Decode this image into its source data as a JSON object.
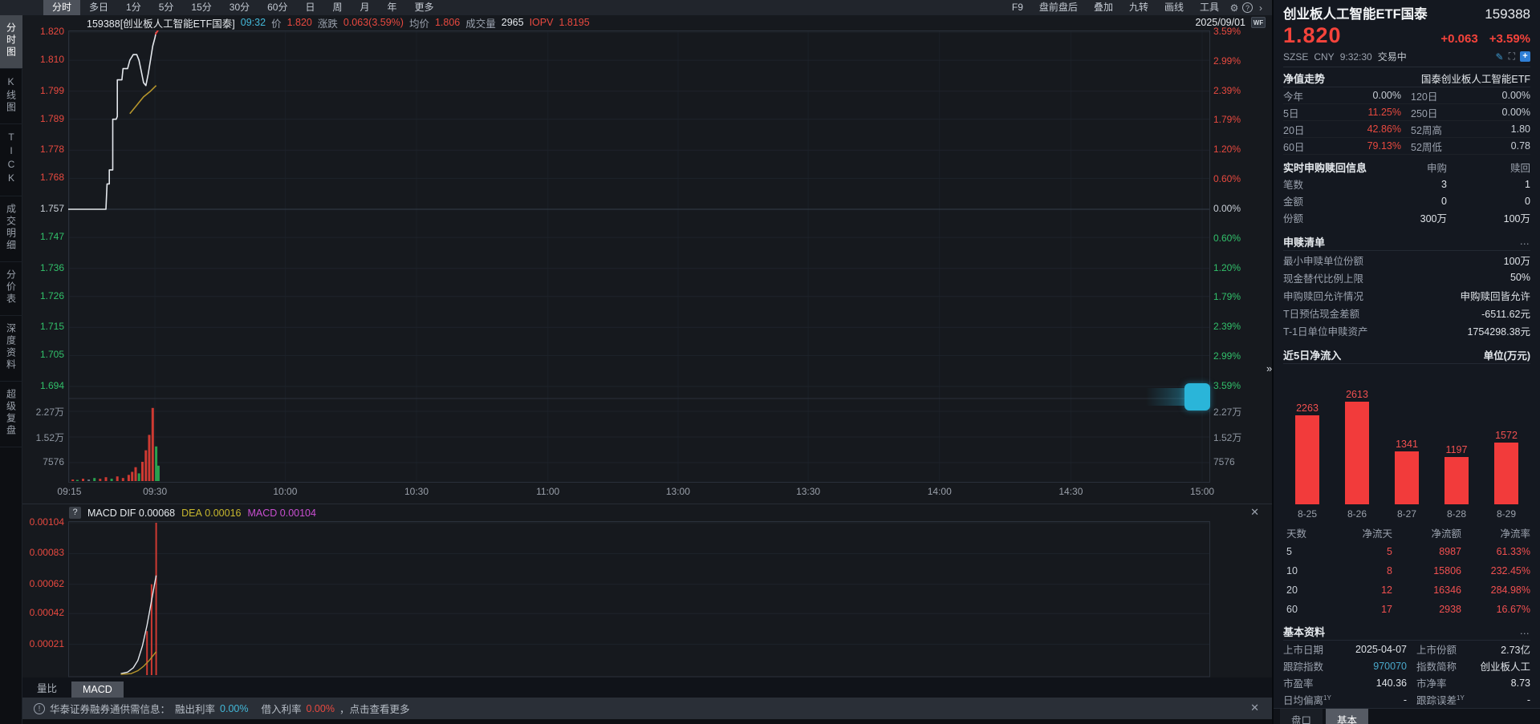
{
  "app": {
    "menu_left": [
      "分时",
      "多日",
      "1分",
      "5分",
      "15分",
      "30分",
      "60分",
      "日",
      "周",
      "月",
      "年",
      "更多"
    ],
    "menu_selected": "分时",
    "menu_right": [
      "F9",
      "盘前盘后",
      "叠加",
      "九转",
      "画线",
      "工具"
    ],
    "sidebar": [
      "分时图",
      "K线图",
      "TICK",
      "成交明细",
      "分价表",
      "深度资料",
      "超级复盘"
    ],
    "sidebar_selected": "分时图",
    "expand_handle": "»"
  },
  "info_bar": {
    "code_name": "159388[创业板人工智能ETF国泰]",
    "time": "09:32",
    "price_label": "价",
    "price": "1.820",
    "change_label": "涨跌",
    "change": "0.063(3.59%)",
    "avg_label": "均价",
    "avg": "1.806",
    "volume_label": "成交量",
    "volume": "2965",
    "iopv_label": "IOPV",
    "iopv": "1.8195",
    "date": "2025/09/01",
    "logo": "WF"
  },
  "chart": {
    "time_axis": [
      {
        "label": "09:15",
        "x": 0.001
      },
      {
        "label": "09:30",
        "x": 0.076
      },
      {
        "label": "10:00",
        "x": 0.19
      },
      {
        "label": "10:30",
        "x": 0.305
      },
      {
        "label": "11:00",
        "x": 0.42
      },
      {
        "label": "13:00",
        "x": 0.534
      },
      {
        "label": "13:30",
        "x": 0.648
      },
      {
        "label": "14:00",
        "x": 0.763
      },
      {
        "label": "14:30",
        "x": 0.878
      },
      {
        "label": "15:00",
        "x": 0.993
      }
    ]
  },
  "chart_data": [
    {
      "type": "line",
      "title": "159388 创业板人工智能ETF国泰 分时走势",
      "prev_close": 1.757,
      "last_price": 1.82,
      "last_time": "09:32",
      "price_ticks": [
        1.82,
        1.81,
        1.799,
        1.789,
        1.778,
        1.768,
        1.757,
        1.747,
        1.736,
        1.726,
        1.715,
        1.705,
        1.694
      ],
      "pct_ticks": [
        "3.59%",
        "2.99%",
        "2.39%",
        "1.79%",
        "1.20%",
        "0.60%",
        "0.00%",
        "0.60%",
        "1.20%",
        "1.79%",
        "2.39%",
        "2.99%",
        "3.59%"
      ],
      "x_labels": [
        "09:15",
        "09:30",
        "10:00",
        "10:30",
        "11:00",
        "13:00",
        "13:30",
        "14:00",
        "14:30",
        "15:00"
      ],
      "volume_ticks": [
        "2.27万",
        "1.52万",
        "7576"
      ],
      "series": [
        {
          "name": "price",
          "color": "#e3e7ec",
          "points": [
            [
              0.0,
              1.757
            ],
            [
              0.033,
              1.757
            ],
            [
              0.034,
              1.766
            ],
            [
              0.036,
              1.766
            ],
            [
              0.036,
              1.771
            ],
            [
              0.039,
              1.771
            ],
            [
              0.039,
              1.789
            ],
            [
              0.042,
              1.789
            ],
            [
              0.043,
              1.79
            ],
            [
              0.043,
              1.803
            ],
            [
              0.047,
              1.803
            ],
            [
              0.048,
              1.807
            ],
            [
              0.052,
              1.807
            ],
            [
              0.054,
              1.81
            ],
            [
              0.057,
              1.812
            ],
            [
              0.06,
              1.812
            ],
            [
              0.062,
              1.81
            ],
            [
              0.064,
              1.806
            ],
            [
              0.066,
              1.802
            ],
            [
              0.068,
              1.801
            ],
            [
              0.07,
              1.805
            ],
            [
              0.072,
              1.81
            ],
            [
              0.074,
              1.815
            ],
            [
              0.076,
              1.818
            ],
            [
              0.077,
              1.82
            ]
          ]
        },
        {
          "name": "avg",
          "color": "#b5952c",
          "points": [
            [
              0.054,
              1.791
            ],
            [
              0.06,
              1.794
            ],
            [
              0.066,
              1.797
            ],
            [
              0.072,
              1.799
            ],
            [
              0.077,
              1.801
            ]
          ]
        }
      ],
      "volume_bars": [
        {
          "x": 0.004,
          "h": 0.02,
          "c": "up"
        },
        {
          "x": 0.008,
          "h": 0.015,
          "c": "down"
        },
        {
          "x": 0.013,
          "h": 0.03,
          "c": "up"
        },
        {
          "x": 0.018,
          "h": 0.02,
          "c": "gray"
        },
        {
          "x": 0.023,
          "h": 0.04,
          "c": "down"
        },
        {
          "x": 0.028,
          "h": 0.03,
          "c": "up"
        },
        {
          "x": 0.033,
          "h": 0.05,
          "c": "up"
        },
        {
          "x": 0.038,
          "h": 0.03,
          "c": "down"
        },
        {
          "x": 0.043,
          "h": 0.06,
          "c": "up"
        },
        {
          "x": 0.048,
          "h": 0.04,
          "c": "up"
        },
        {
          "x": 0.053,
          "h": 0.08,
          "c": "up"
        },
        {
          "x": 0.056,
          "h": 0.12,
          "c": "up"
        },
        {
          "x": 0.059,
          "h": 0.18,
          "c": "up"
        },
        {
          "x": 0.062,
          "h": 0.1,
          "c": "down"
        },
        {
          "x": 0.065,
          "h": 0.25,
          "c": "up"
        },
        {
          "x": 0.068,
          "h": 0.4,
          "c": "up"
        },
        {
          "x": 0.071,
          "h": 0.6,
          "c": "up"
        },
        {
          "x": 0.074,
          "h": 0.95,
          "c": "up"
        },
        {
          "x": 0.077,
          "h": 0.45,
          "c": "down"
        },
        {
          "x": 0.079,
          "h": 0.2,
          "c": "down"
        }
      ]
    },
    {
      "type": "bar",
      "title": "近5日净流入",
      "unit": "单位(万元)",
      "categories": [
        "8-25",
        "8-26",
        "8-27",
        "8-28",
        "8-29"
      ],
      "values": [
        2263,
        2613,
        1341,
        1197,
        1572
      ]
    },
    {
      "type": "line",
      "title": "MACD",
      "dif": 0.00068,
      "dea": 0.00016,
      "macd": 0.00104,
      "axis_ticks": [
        0.00104,
        0.00083,
        0.00062,
        0.00042,
        0.00021
      ],
      "series": [
        {
          "name": "DIF",
          "color": "#e3e7ec",
          "points": [
            [
              0.046,
              1e-05
            ],
            [
              0.052,
              2e-05
            ],
            [
              0.057,
              5e-05
            ],
            [
              0.061,
              0.0001
            ],
            [
              0.065,
              0.0002
            ],
            [
              0.069,
              0.00034
            ],
            [
              0.073,
              0.00051
            ],
            [
              0.077,
              0.00068
            ]
          ]
        },
        {
          "name": "DEA",
          "color": "#b5952c",
          "points": [
            [
              0.046,
              5e-06
            ],
            [
              0.055,
              1e-05
            ],
            [
              0.061,
              3e-05
            ],
            [
              0.066,
              6e-05
            ],
            [
              0.071,
              0.0001
            ],
            [
              0.077,
              0.00016
            ]
          ]
        }
      ],
      "histogram": [
        {
          "x": 0.069,
          "v": 0.0003
        },
        {
          "x": 0.073,
          "v": 0.00062
        },
        {
          "x": 0.077,
          "v": 0.00104
        }
      ]
    }
  ],
  "macd_bar": {
    "help": "?",
    "name": "MACD",
    "dif_label": "DIF",
    "dif": "0.00068",
    "dea_label": "DEA",
    "dea": "0.00016",
    "macd_label": "MACD",
    "macd": "0.00104",
    "close": "✕"
  },
  "bottom_tabs": {
    "tabs": [
      "量比",
      "MACD"
    ],
    "selected": "MACD"
  },
  "notice": {
    "icon": "!",
    "text": "华泰证券融券通供需信息：",
    "out_label": "融出利率",
    "out_value": "0.00%",
    "in_label": "借入利率",
    "in_value": "0.00%",
    "more": "，点击查看更多",
    "close": "✕"
  },
  "panel": {
    "name": "创业板人工智能ETF国泰",
    "code": "159388",
    "price": "1.820",
    "change": "+0.063",
    "change_pct": "+3.59%",
    "exchange": "SZSE",
    "currency": "CNY",
    "time": "9:32:30",
    "status": "交易中",
    "nav": {
      "title": "净值走势",
      "fund": "国泰创业板人工智能ETF",
      "rows": [
        {
          "l1": "今年",
          "v1": "0.00%",
          "c1": "flat",
          "l2": "120日",
          "v2": "0.00%",
          "c2": "flat"
        },
        {
          "l1": "5日",
          "v1": "11.25%",
          "c1": "up",
          "l2": "250日",
          "v2": "0.00%",
          "c2": "flat"
        },
        {
          "l1": "20日",
          "v1": "42.86%",
          "c1": "up",
          "l2": "52周高",
          "v2": "1.80",
          "c2": "flat"
        },
        {
          "l1": "60日",
          "v1": "79.13%",
          "c1": "up",
          "l2": "52周低",
          "v2": "0.78",
          "c2": "flat"
        }
      ]
    },
    "realtime": {
      "title": "实时申购赎回信息",
      "col1": "申购",
      "col2": "赎回",
      "rows": [
        {
          "label": "笔数",
          "v1": "3",
          "v2": "1"
        },
        {
          "label": "金额",
          "v1": "0",
          "v2": "0"
        },
        {
          "label": "份额",
          "v1": "300万",
          "v2": "100万"
        }
      ]
    },
    "shenshu": {
      "title": "申赎清单",
      "more": "…",
      "rows": [
        {
          "label": "最小申赎单位份额",
          "value": "100万"
        },
        {
          "label": "现金替代比例上限",
          "value": "50%"
        },
        {
          "label": "申购赎回允许情况",
          "value": "申购赎回皆允许"
        },
        {
          "label": "T日预估现金差额",
          "value": "-6511.62元"
        },
        {
          "label": "T-1日单位申赎资产",
          "value": "1754298.38元"
        }
      ]
    },
    "flow": {
      "title": "近5日净流入",
      "unit": "单位(万元)",
      "table": {
        "headers": [
          "天数",
          "净流天",
          "净流额",
          "净流率"
        ],
        "rows": [
          [
            "5",
            "5",
            "8987",
            "61.33%"
          ],
          [
            "10",
            "8",
            "15806",
            "232.45%"
          ],
          [
            "20",
            "12",
            "16346",
            "284.98%"
          ],
          [
            "60",
            "17",
            "2938",
            "16.67%"
          ]
        ]
      }
    },
    "basic": {
      "title": "基本资料",
      "more": "…",
      "rows": [
        {
          "l1": "上市日期",
          "v1": "2025-04-07",
          "l2": "上市份额",
          "v2": "2.73亿"
        },
        {
          "l1": "跟踪指数",
          "v1": "970070",
          "v1c": "link",
          "l2": "指数简称",
          "v2": "创业板人工"
        },
        {
          "l1": "市盈率",
          "v1": "140.36",
          "l2": "市净率",
          "v2": "8.73"
        },
        {
          "l1": "日均偏离",
          "l1sup": "1Y",
          "v1": "-",
          "l2": "跟踪误差",
          "l2sup": "1Y",
          "v2": "-"
        }
      ]
    },
    "tabs": [
      "盘口",
      "基本"
    ],
    "tab_selected": "基本"
  }
}
